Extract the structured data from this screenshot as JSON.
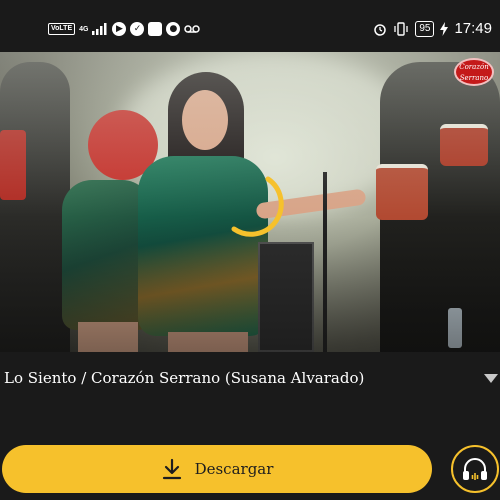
{
  "status_bar": {
    "volte": "VoLTE",
    "network": "4G",
    "battery": "95",
    "time": "17:49"
  },
  "video": {
    "channel_logo_line1": "Corazón",
    "channel_logo_line2": "Serrano",
    "loading_color": "#f6c12c"
  },
  "track": {
    "title": "Lo Siento / Corazón Serrano (Susana Alvarado)"
  },
  "actions": {
    "download_label": "Descargar",
    "accent_color": "#f6c12c"
  }
}
